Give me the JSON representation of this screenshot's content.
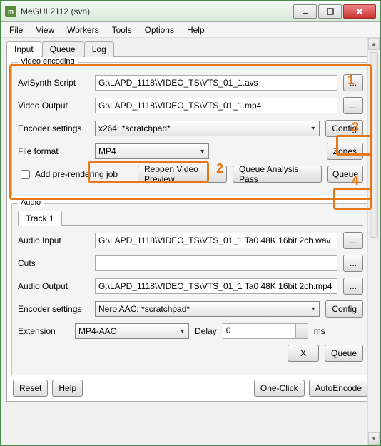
{
  "window": {
    "title": "MeGUI 2112 (svn)"
  },
  "menu": [
    "File",
    "View",
    "Workers",
    "Tools",
    "Options",
    "Help"
  ],
  "mainTabs": [
    "Input",
    "Queue",
    "Log"
  ],
  "mainActiveTab": 0,
  "videoGroup": {
    "label": "Video encoding",
    "avisynthLabel": "AviSynth Script",
    "avisynthValue": "G:\\LAPD_1118\\VIDEO_TS\\VTS_01_1.avs",
    "outputLabel": "Video Output",
    "outputValue": "G:\\LAPD_1118\\VIDEO_TS\\VTS_01_1.mp4",
    "encoderLabel": "Encoder settings",
    "encoderValue": "x264: *scratchpad*",
    "configBtn": "Config",
    "formatLabel": "File format",
    "formatValue": "MP4",
    "zonesBtn": "Zones",
    "addPreRender": "Add pre-rendering job",
    "reopenBtn": "Reopen Video Preview",
    "analysisBtn": "Queue Analysis Pass",
    "queueBtn": "Queue"
  },
  "audioGroup": {
    "label": "Audio",
    "trackTabs": [
      "Track 1"
    ],
    "inputLabel": "Audio Input",
    "inputValue": "G:\\LAPD_1118\\VIDEO_TS\\VTS_01_1 Ta0 48K 16bit 2ch.wav",
    "cutsLabel": "Cuts",
    "cutsValue": "",
    "outputLabel": "Audio Output",
    "outputValue": "G:\\LAPD_1118\\VIDEO_TS\\VTS_01_1 Ta0 48K 16bit 2ch.mp4",
    "encoderLabel": "Encoder settings",
    "encoderValue": "Nero AAC: *scratchpad*",
    "configBtn": "Config",
    "extLabel": "Extension",
    "extValue": "MP4-AAC",
    "delayLabel": "Delay",
    "delayValue": "0",
    "delayUnit": "ms",
    "xBtn": "X",
    "queueBtn": "Queue"
  },
  "footer": {
    "reset": "Reset",
    "help": "Help",
    "oneClick": "One-Click",
    "autoEncode": "AutoEncode"
  },
  "annotations": {
    "n1": "1",
    "n2": "2",
    "n3": "3",
    "n4": "4"
  }
}
